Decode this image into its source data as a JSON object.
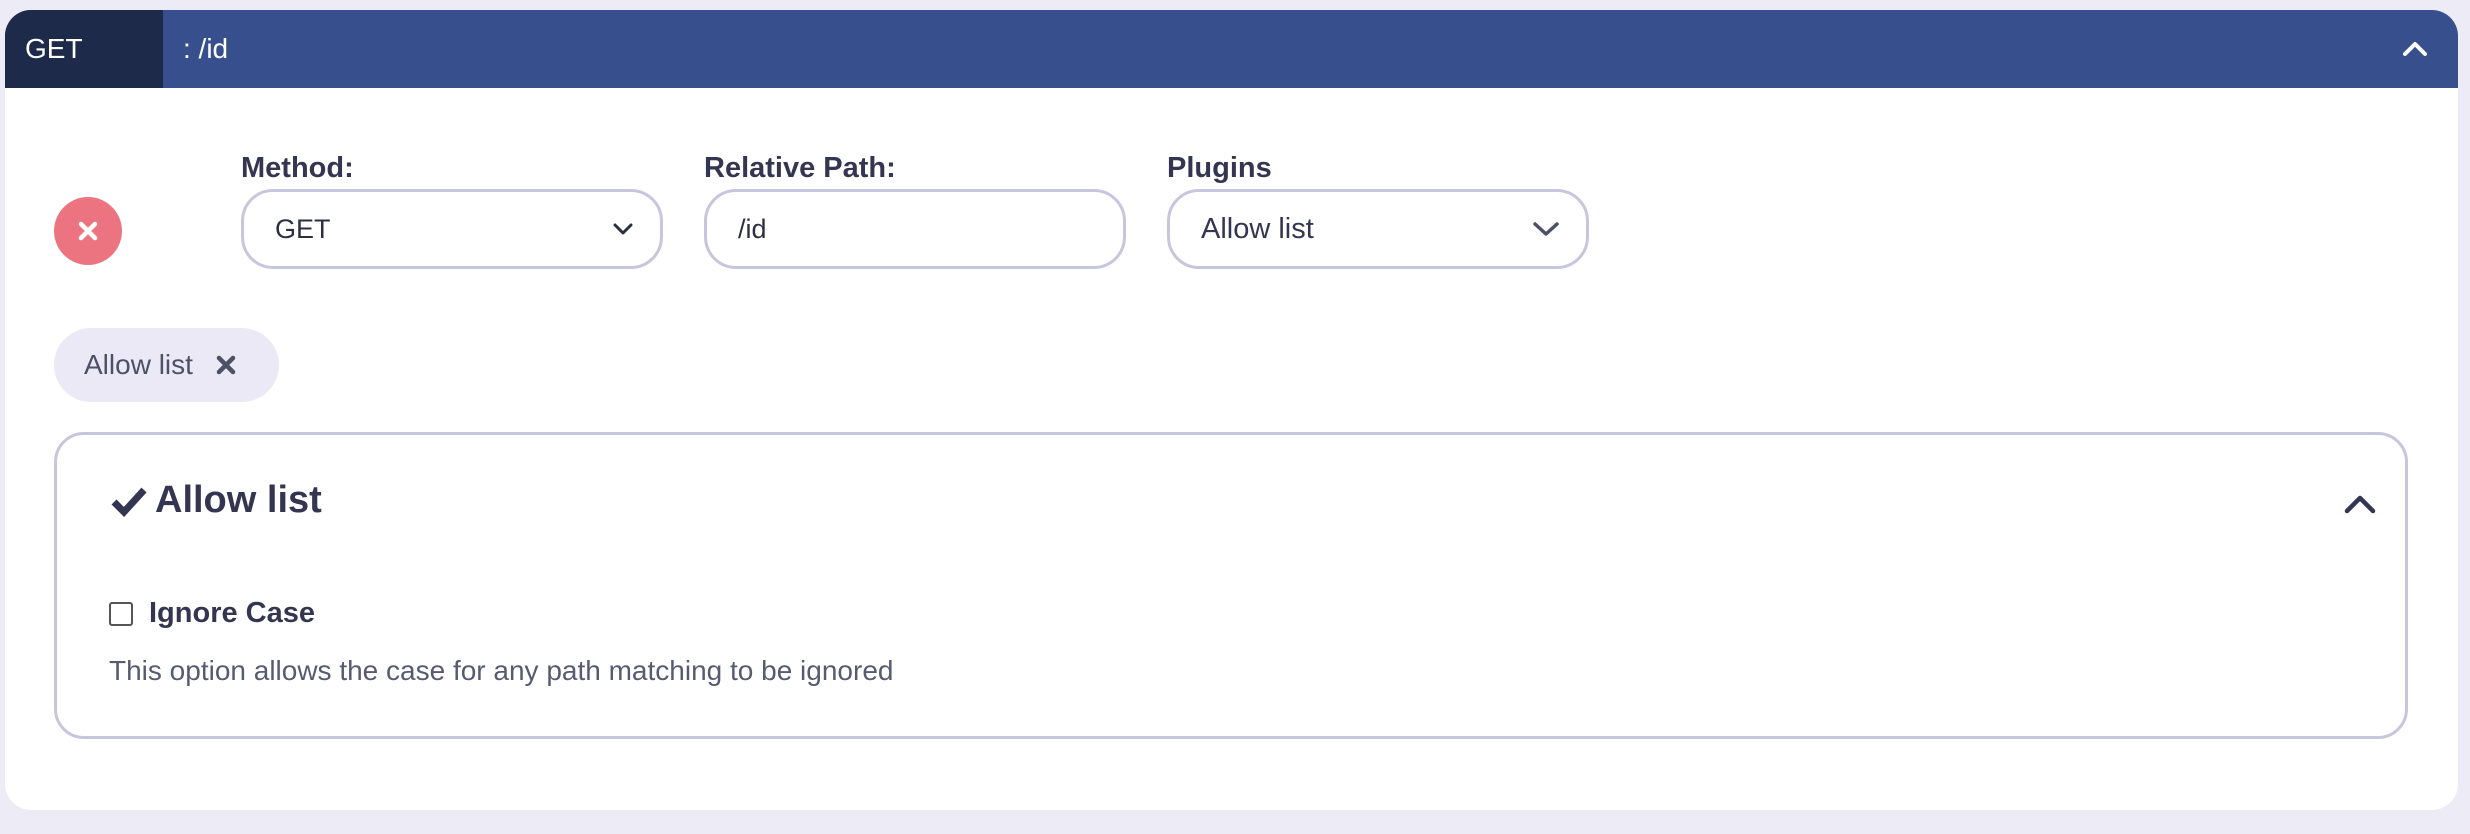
{
  "header": {
    "method_badge": "GET",
    "path": ": /id"
  },
  "form": {
    "method": {
      "label": "Method:",
      "value": "GET"
    },
    "relative_path": {
      "label": "Relative Path:",
      "value": "/id"
    },
    "plugins": {
      "label": "Plugins",
      "value": "Allow list"
    }
  },
  "chips": [
    {
      "label": "Allow list"
    }
  ],
  "plugin_panel": {
    "title": "Allow list",
    "options": [
      {
        "label": "Ignore Case",
        "checked": false,
        "description": "This option allows the case for any path matching to be ignored"
      }
    ]
  },
  "colors": {
    "header_bg": "#37508d",
    "badge_bg": "#1e2a4a",
    "remove_button": "#ec7480",
    "page_bg": "#ecebf6"
  },
  "icons": {
    "header_toggle": "chevron-up-icon",
    "remove": "close-icon",
    "select_arrow": "chevron-down-icon",
    "chip_remove": "close-icon",
    "panel_status": "checkmark-icon",
    "panel_toggle": "chevron-up-icon"
  }
}
